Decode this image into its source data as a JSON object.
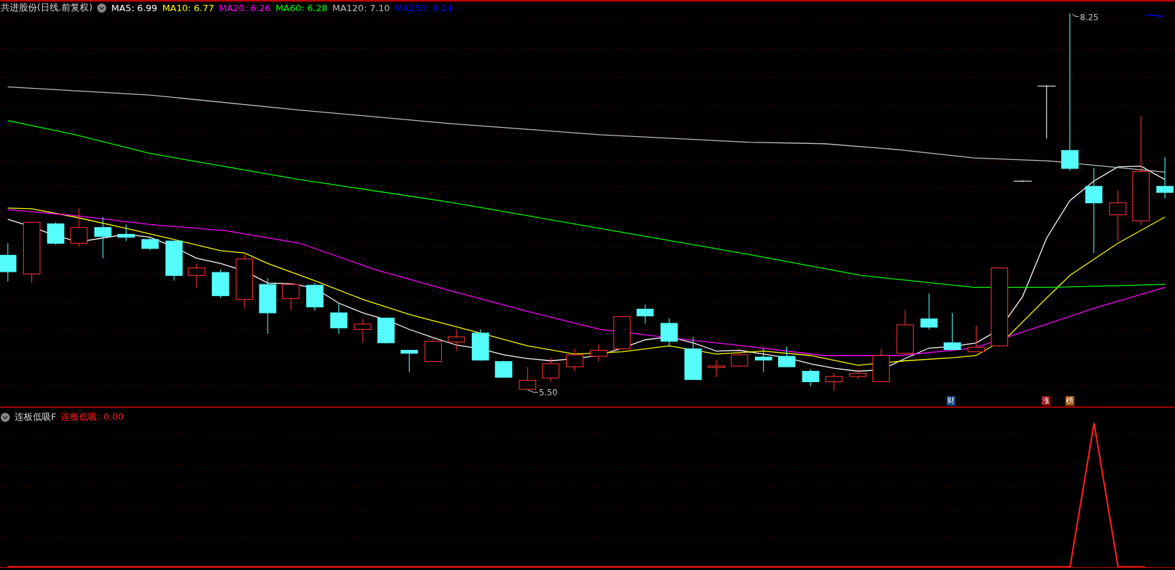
{
  "upper_pane": {
    "title": "共进股份(日线.前复权)",
    "indicators": [
      {
        "label": "MA5: 6.99",
        "color": "#ffffff"
      },
      {
        "label": "MA10: 6.77",
        "color": "#ffff00"
      },
      {
        "label": "MA20: 6.26",
        "color": "#ff00ff"
      },
      {
        "label": "MA60: 6.28",
        "color": "#00ff00"
      },
      {
        "label": "MA120: 7.10",
        "color": "#c0c0c0"
      },
      {
        "label": "MA250: 8.24",
        "color": "#0000ff"
      }
    ],
    "high_mark": "8.25",
    "low_mark": "5.50",
    "badges": [
      {
        "text": "财",
        "color": "#0a3d7a"
      },
      {
        "text": "涨",
        "color": "#8a0000"
      },
      {
        "text": "榜",
        "color": "#9a4a00"
      }
    ]
  },
  "lower_pane": {
    "title": "连板低吸F",
    "value_label": "连板低吸: 0.00"
  }
}
